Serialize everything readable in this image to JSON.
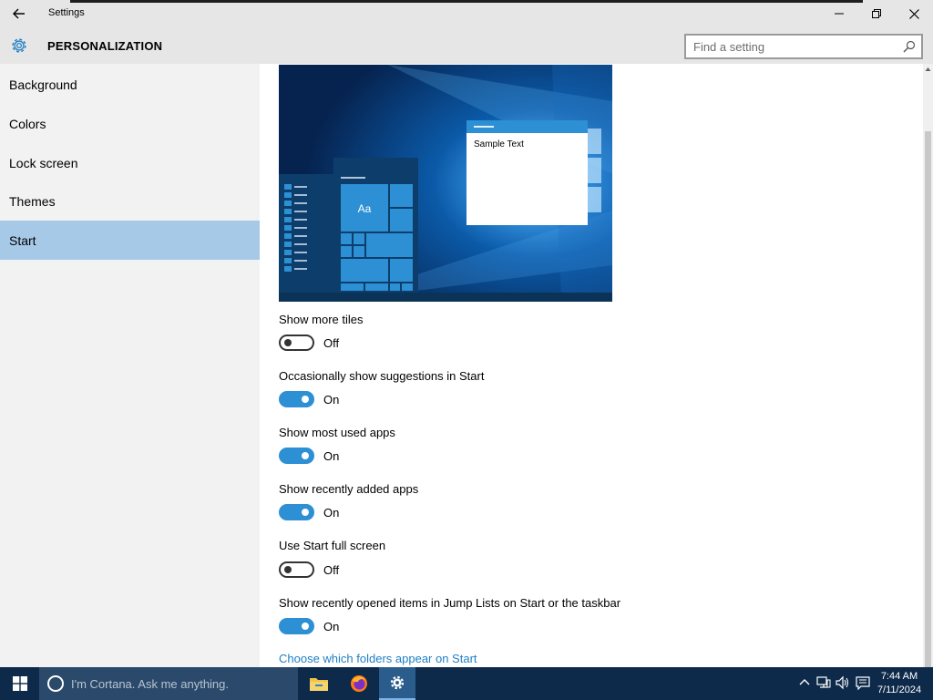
{
  "window": {
    "title": "Settings"
  },
  "header": {
    "title": "PERSONALIZATION",
    "search_placeholder": "Find a setting"
  },
  "sidebar": {
    "items": [
      {
        "label": "Background"
      },
      {
        "label": "Colors"
      },
      {
        "label": "Lock screen"
      },
      {
        "label": "Themes"
      },
      {
        "label": "Start",
        "selected": true
      }
    ]
  },
  "preview": {
    "sample_text": "Sample Text",
    "tile_text": "Aa"
  },
  "settings": [
    {
      "label": "Show more tiles",
      "state": "Off"
    },
    {
      "label": "Occasionally show suggestions in Start",
      "state": "On"
    },
    {
      "label": "Show most used apps",
      "state": "On"
    },
    {
      "label": "Show recently added apps",
      "state": "On"
    },
    {
      "label": "Use Start full screen",
      "state": "Off"
    },
    {
      "label": "Show recently opened items in Jump Lists on Start or the taskbar",
      "state": "On"
    }
  ],
  "link": {
    "label": "Choose which folders appear on Start"
  },
  "taskbar": {
    "cortana_placeholder": "I'm Cortana. Ask me anything.",
    "time": "7:44 AM",
    "date": "7/11/2024"
  },
  "colors": {
    "accent": "#2d8fd4",
    "sidebar_selected": "#a6c9e8",
    "link": "#1f7fc4",
    "taskbar": "#0d2a4a"
  }
}
